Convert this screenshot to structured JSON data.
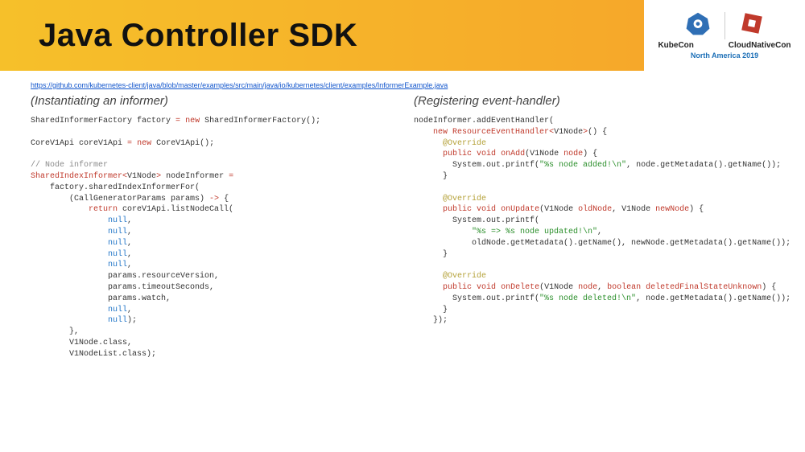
{
  "header": {
    "title": "Java Controller SDK",
    "logo1_label": "KubeCon",
    "logo2_label": "CloudNativeCon",
    "subtitle": "North America 2019"
  },
  "link": {
    "url_text": "https://github.com/kubernetes-client/java/blob/master/examples/src/main/java/io/kubernetes/client/examples/InformerExample.java"
  },
  "left": {
    "heading": "(Instantiating an informer)",
    "code": {
      "l01a": "SharedInformerFactory factory ",
      "l01b": "=",
      "l01c": " ",
      "l01d": "new",
      "l01e": " SharedInformerFactory();",
      "l02a": "CoreV1Api coreV1Api ",
      "l02b": "=",
      "l02c": " ",
      "l02d": "new",
      "l02e": " CoreV1Api();",
      "l03": "// Node informer",
      "l04a": "SharedIndexInformer",
      "l04b": "<",
      "l04c": "V1Node",
      "l04d": ">",
      "l04e": " nodeInformer ",
      "l04f": "=",
      "l05": "    factory.sharedIndexInformerFor(",
      "l06a": "        (CallGeneratorParams params) ",
      "l06b": "->",
      "l06c": " {",
      "l07a": "            ",
      "l07b": "return",
      "l07c": " coreV1Api.listNodeCall(",
      "lnull_indent": "                ",
      "lnull": "null",
      "lcomma": ",",
      "l13": "                params.resourceVersion,",
      "l14": "                params.timeoutSeconds,",
      "l15": "                params.watch,",
      "l17b": ");",
      "l18": "        },",
      "l19": "        V1Node.class,",
      "l20": "        V1NodeList.class);"
    }
  },
  "right": {
    "heading": "(Registering event-handler)",
    "code": {
      "l01": "nodeInformer.addEventHandler(",
      "l02a": "    ",
      "l02b": "new",
      "l02c": " ResourceEventHandler",
      "l02d": "<",
      "l02e": "V1Node",
      "l02f": ">",
      "l02g": "() {",
      "l03a": "      ",
      "l03b": "@Override",
      "l04a": "      ",
      "l04b": "public",
      "l04c": " ",
      "l04d": "void",
      "l04e": " ",
      "l04f": "onAdd",
      "l04g": "(V1Node ",
      "l04h": "node",
      "l04i": ") {",
      "l05a": "        System.out.printf(",
      "l05b": "\"%s node added!\\n\"",
      "l05c": ", node.getMetadata().getName());",
      "l06": "      }",
      "l08a": "      ",
      "l08b": "public",
      "l08c": " ",
      "l08d": "void",
      "l08e": " ",
      "l08f": "onUpdate",
      "l08g": "(V1Node ",
      "l08h": "oldNode",
      "l08i": ", V1Node ",
      "l08j": "newNode",
      "l08k": ") {",
      "l09": "        System.out.printf(",
      "l10a": "            ",
      "l10b": "\"%s => %s node updated!\\n\"",
      "l10c": ",",
      "l11": "            oldNode.getMetadata().getName(), newNode.getMetadata().getName());",
      "l14a": "      ",
      "l14b": "public",
      "l14c": " ",
      "l14d": "void",
      "l14e": " ",
      "l14f": "onDelete",
      "l14g": "(V1Node ",
      "l14h": "node",
      "l14i": ", ",
      "l14j": "boolean",
      "l14k": " ",
      "l14l": "deletedFinalStateUnknown",
      "l14m": ") {",
      "l15a": "        System.out.printf(",
      "l15b": "\"%s node deleted!\\n\"",
      "l15c": ", node.getMetadata().getName());",
      "l17": "    });"
    }
  }
}
